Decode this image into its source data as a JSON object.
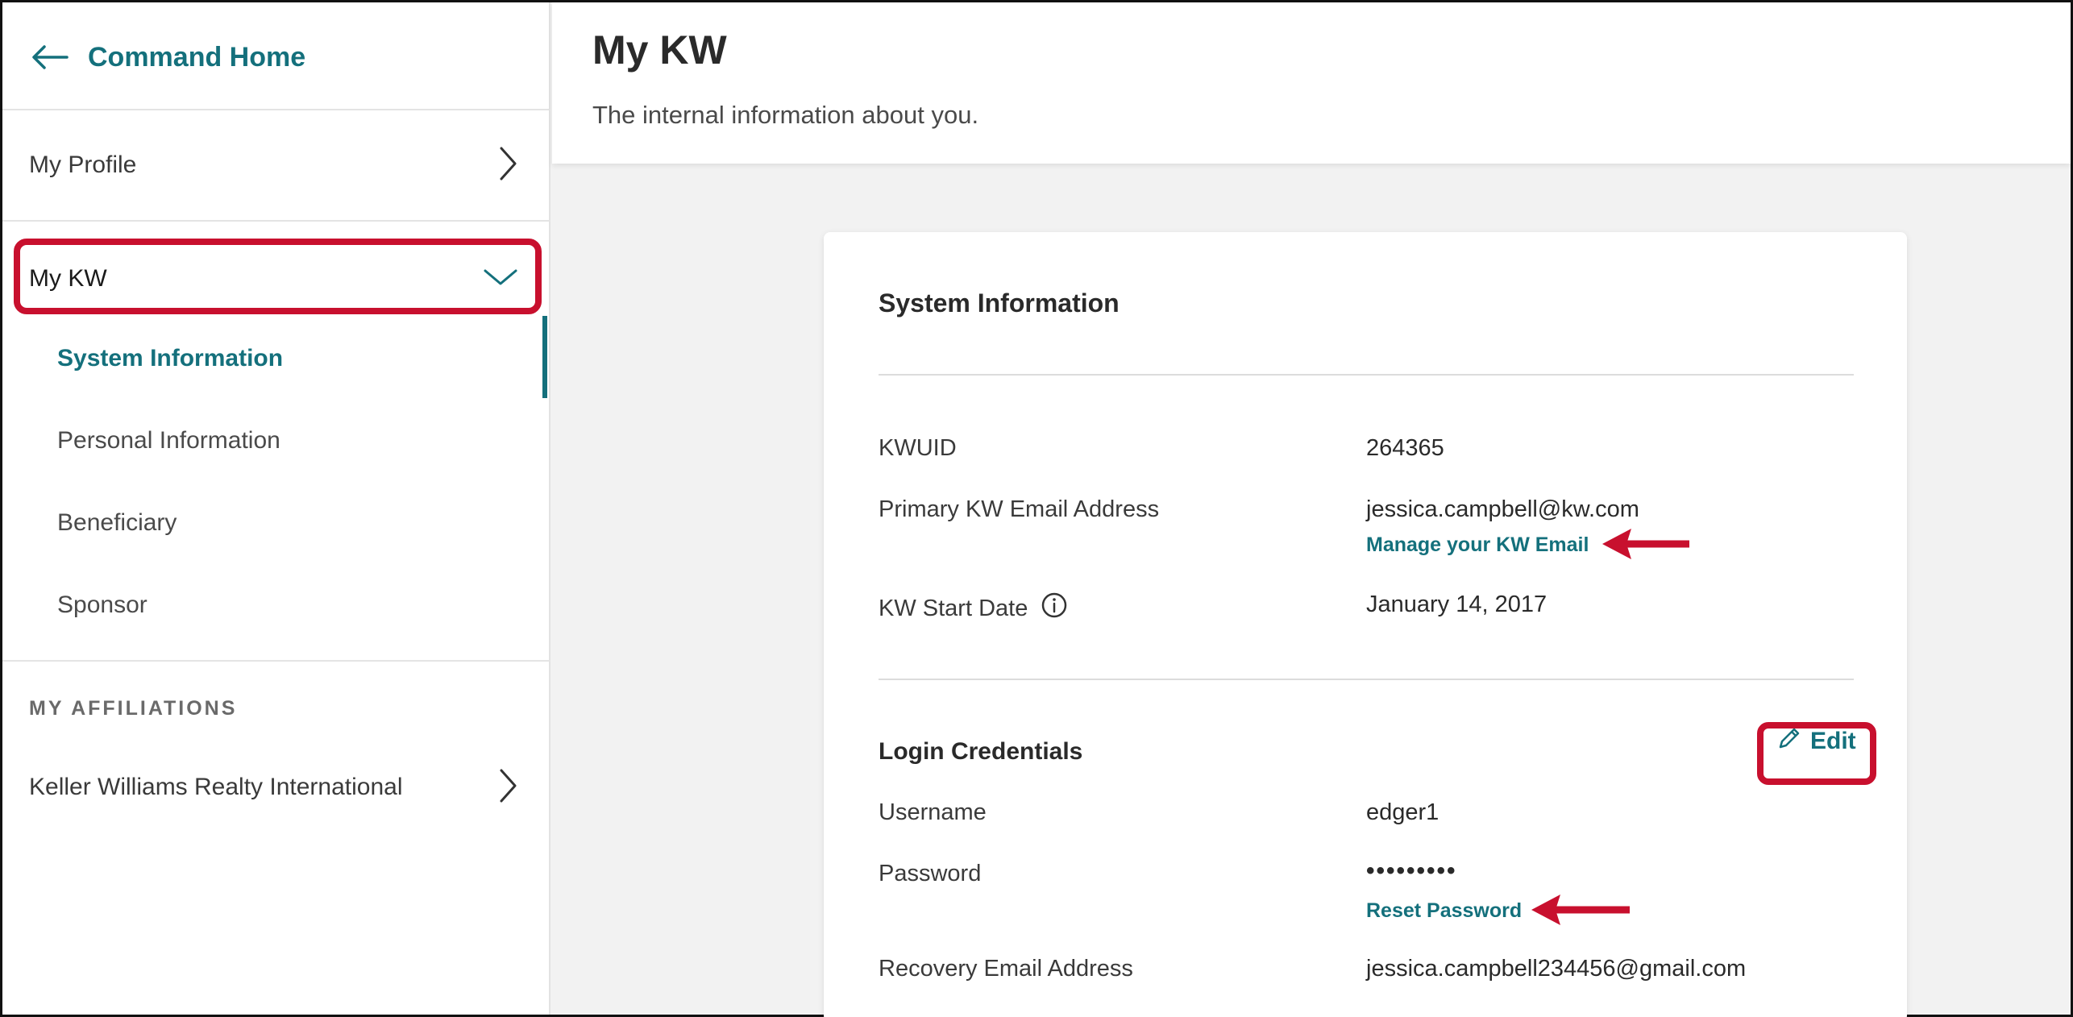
{
  "sidebar": {
    "back_label": "Command Home",
    "items": [
      {
        "label": "My Profile"
      },
      {
        "label": "My KW"
      }
    ],
    "sub_items": [
      {
        "label": "System Information",
        "active": true
      },
      {
        "label": "Personal Information"
      },
      {
        "label": "Beneficiary"
      },
      {
        "label": "Sponsor"
      }
    ],
    "affiliations_heading": "MY AFFILIATIONS",
    "affiliations": [
      {
        "label": "Keller Williams Realty International"
      }
    ]
  },
  "header": {
    "title": "My KW",
    "subtitle": "The internal information about you."
  },
  "card": {
    "title": "System Information",
    "fields": {
      "kwuid_label": "KWUID",
      "kwuid_value": "264365",
      "email_label": "Primary KW Email Address",
      "email_value": "jessica.campbell@kw.com",
      "email_link": "Manage your KW Email",
      "start_label": "KW Start Date",
      "start_value": "January 14, 2017"
    },
    "login": {
      "heading": "Login Credentials",
      "edit_label": "Edit",
      "username_label": "Username",
      "username_value": "edger1",
      "password_label": "Password",
      "password_value": "•••••••••",
      "reset_link": "Reset Password",
      "recovery_label": "Recovery Email Address",
      "recovery_value": "jessica.campbell234456@gmail.com"
    }
  },
  "colors": {
    "accent": "#14707c",
    "annotation": "#c8102e"
  }
}
